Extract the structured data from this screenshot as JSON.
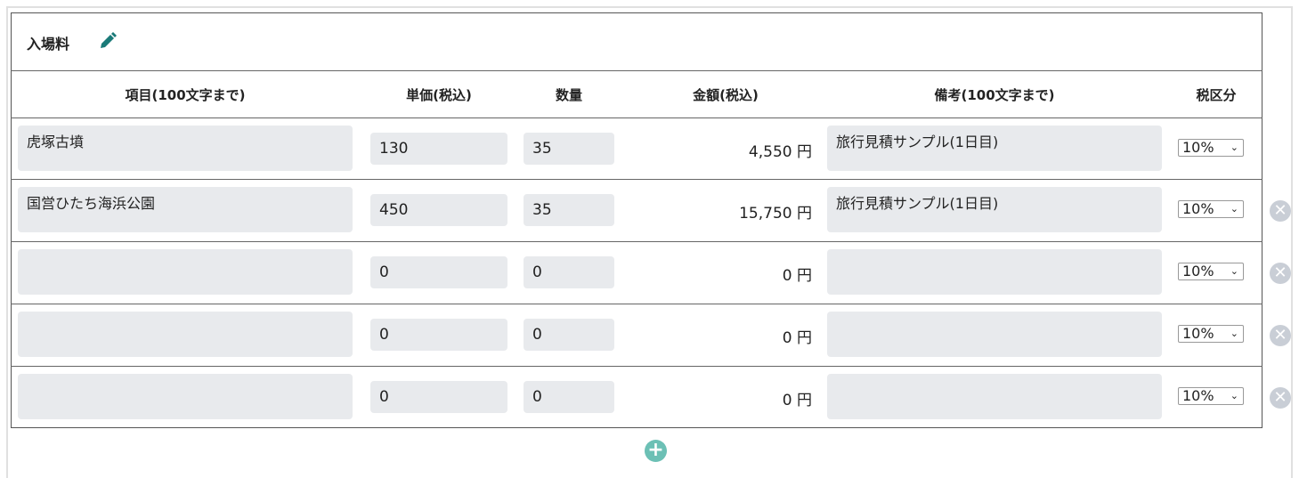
{
  "section": {
    "title": "入場料",
    "edit_icon": "pencil-icon"
  },
  "columns": [
    "項目(100文字まで)",
    "単価(税込)",
    "数量",
    "金額(税込)",
    "備考(100文字まで)",
    "税区分"
  ],
  "rows": [
    {
      "item": "虎塚古墳",
      "price": "130",
      "qty": "35",
      "amount": "4,550 円",
      "note": "旅行見積サンプル(1日目)",
      "tax": "10%",
      "deletable": false
    },
    {
      "item": "国営ひたち海浜公園",
      "price": "450",
      "qty": "35",
      "amount": "15,750 円",
      "note": "旅行見積サンプル(1日目)",
      "tax": "10%",
      "deletable": true
    },
    {
      "item": "",
      "price": "0",
      "qty": "0",
      "amount": "0 円",
      "note": "",
      "tax": "10%",
      "deletable": true
    },
    {
      "item": "",
      "price": "0",
      "qty": "0",
      "amount": "0 円",
      "note": "",
      "tax": "10%",
      "deletable": true
    },
    {
      "item": "",
      "price": "0",
      "qty": "0",
      "amount": "0 円",
      "note": "",
      "tax": "10%",
      "deletable": true
    }
  ],
  "colors": {
    "accent": "#6cc0b5",
    "pencil": "#1a7a78",
    "field_bg": "#e8eaed"
  }
}
